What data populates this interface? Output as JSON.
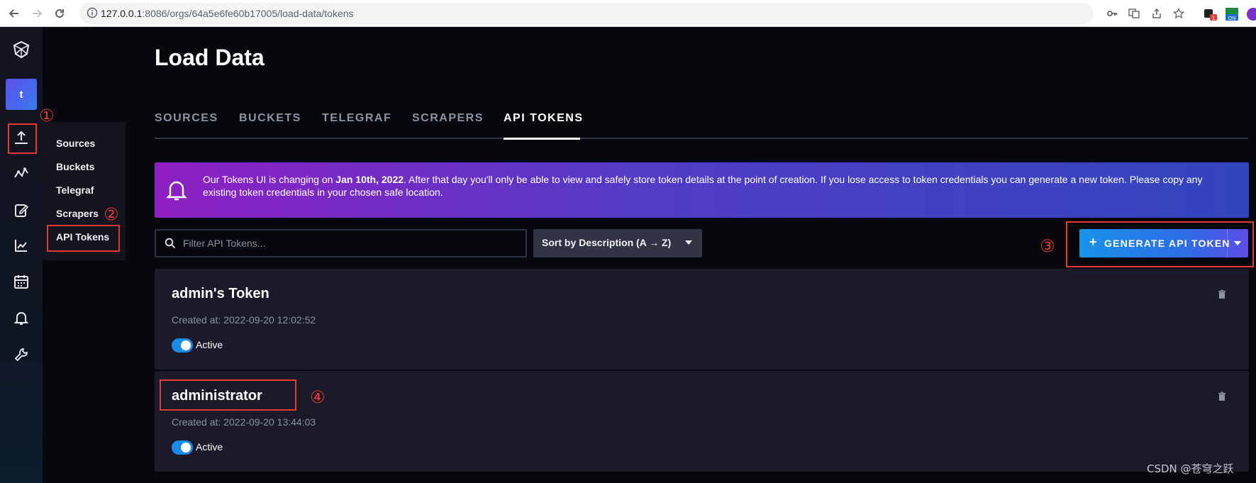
{
  "browser": {
    "url_host": "127.0.0.1",
    "url_rest": ":8086/orgs/64a5e6fe60b17005/load-data/tokens"
  },
  "nav": {
    "org_initial": "t",
    "submenu": [
      "Sources",
      "Buckets",
      "Telegraf",
      "Scrapers",
      "API Tokens"
    ]
  },
  "page": {
    "title": "Load Data",
    "tabs": [
      "SOURCES",
      "BUCKETS",
      "TELEGRAF",
      "SCRAPERS",
      "API TOKENS"
    ],
    "active_tab": "API TOKENS"
  },
  "banner": {
    "text_1": "Our Tokens UI is changing on ",
    "date": "Jan 10th, 2022",
    "text_2": ". After that day you'll only be able to view and safely store token details at the point of creation. If you lose access to token credentials you can generate a new token. Please copy any existing token credentials in your chosen safe location."
  },
  "controls": {
    "filter_placeholder": "Filter API Tokens...",
    "sort_label": "Sort by Description (A → Z)",
    "generate_plus": "+",
    "generate_label": "GENERATE API TOKEN"
  },
  "tokens": [
    {
      "name": "admin's Token",
      "created": "Created at: 2022-09-20 12:02:52",
      "status": "Active"
    },
    {
      "name": "administrator",
      "created": "Created at: 2022-09-20 13:44:03",
      "status": "Active"
    }
  ],
  "annotations": [
    "①",
    "②",
    "③",
    "④"
  ],
  "watermark": "CSDN @苍穹之跃",
  "colors": {
    "accent_blue": "#1a8be8",
    "highlight_red": "#e53935",
    "banner_purple": "#8e1fc3"
  }
}
